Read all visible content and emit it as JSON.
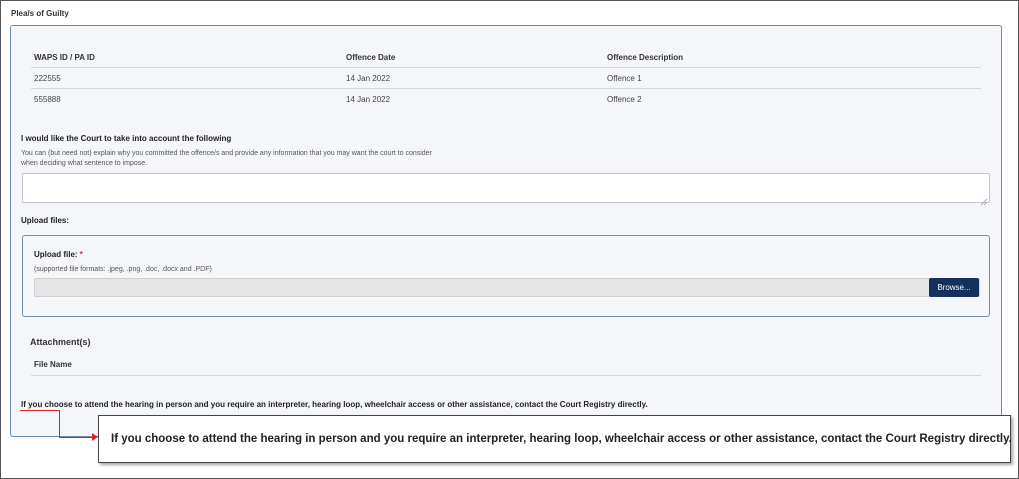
{
  "section": {
    "title": "Plea/s of Guilty"
  },
  "offences_table": {
    "headers": [
      "WAPS ID / PA ID",
      "Offence Date",
      "Offence Description"
    ],
    "rows": [
      [
        "222555",
        "14 Jan 2022",
        "Offence 1"
      ],
      [
        "555888",
        "14 Jan 2022",
        "Offence 2"
      ]
    ]
  },
  "court_note": {
    "label": "I would like the Court to take into account the following",
    "help_line1": "You can (but need not) explain why you committed the offence/s and provide any information that you may want the court to consider",
    "help_line2": "when deciding what sentence to impose.",
    "value": ""
  },
  "upload": {
    "section_label": "Upload files:",
    "file_label": "Upload file:",
    "required_mark": "*",
    "formats": "(supported file formats: .jpeg, .png, .doc, .docx and .PDF)",
    "browse_label": "Browse...",
    "file_value": ""
  },
  "attachments": {
    "title": "Attachment(s)",
    "column": "File Name"
  },
  "assistance_text": "If you choose to attend the hearing in person and you require an interpreter, hearing loop, wheelchair access or other assistance, contact the Court Registry directly.",
  "callout_text": "If you choose to attend the hearing in person and you require an interpreter, hearing loop, wheelchair access or other assistance, contact the Court Registry directly.",
  "colors": {
    "panel_border": "#6d8bab",
    "panel_bg": "#f4f6fa",
    "browse_button": "#13315c",
    "required": "#c0392b",
    "callout_arrow": "#e02020"
  }
}
